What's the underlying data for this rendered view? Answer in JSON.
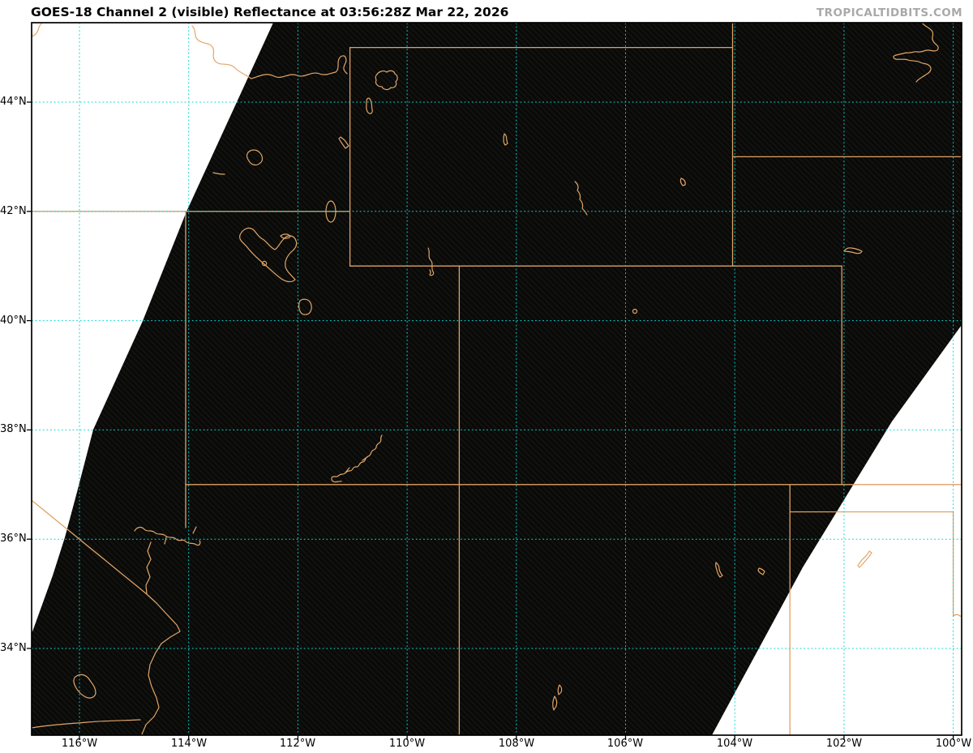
{
  "header": {
    "title": "GOES-18 Channel 2 (visible) Reflectance at 03:56:28Z Mar 22, 2026",
    "watermark": "TROPICALTIDBITS.COM"
  },
  "axes": {
    "lat_labels": [
      "44°N",
      "42°N",
      "40°N",
      "38°N",
      "36°N",
      "34°N"
    ],
    "lon_labels": [
      "116°W",
      "114°W",
      "112°W",
      "110°W",
      "108°W",
      "106°W",
      "104°W",
      "102°W",
      "100°W"
    ]
  },
  "colors": {
    "map_boundary_line": "#dfa164",
    "gridline": "#00d9d9",
    "scan_region_dark": "#0a0a08",
    "background": "#ffffff",
    "watermark_text": "#a9a9a9",
    "axis_text": "#000000"
  }
}
